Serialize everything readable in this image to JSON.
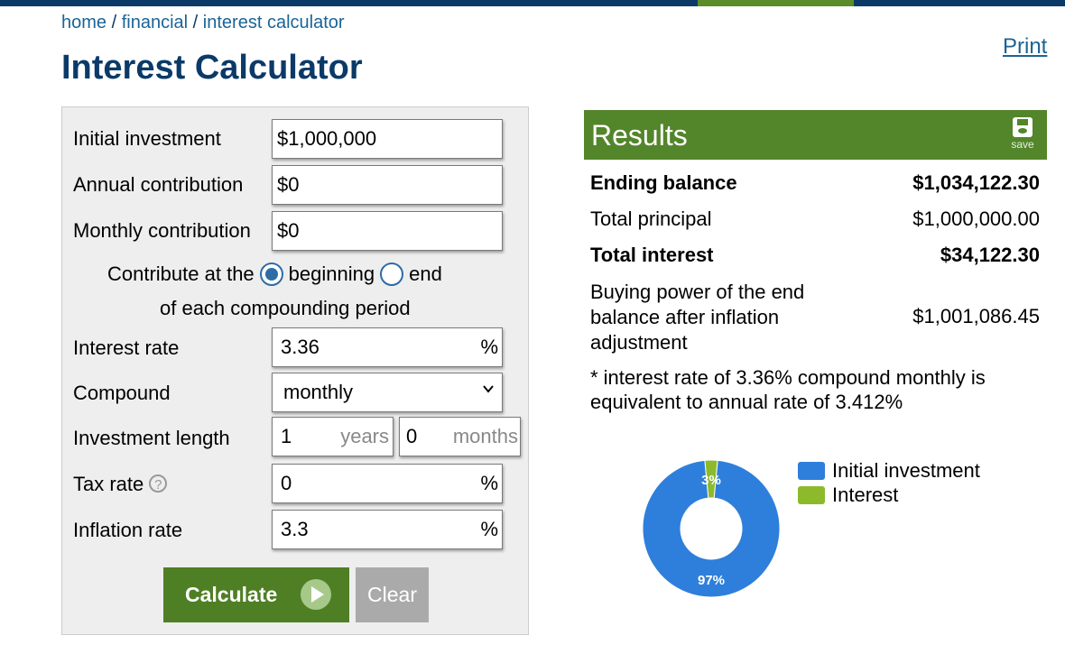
{
  "breadcrumb": {
    "home": "home",
    "sep": "/",
    "financial": "financial",
    "current": "interest calculator"
  },
  "print_label": "Print",
  "page_title": "Interest Calculator",
  "form": {
    "initial_investment": {
      "label": "Initial investment",
      "value": "$1,000,000"
    },
    "annual_contribution": {
      "label": "Annual contribution",
      "value": "$0"
    },
    "monthly_contribution": {
      "label": "Monthly contribution",
      "value": "$0"
    },
    "contribute_at": {
      "prefix": "Contribute at the",
      "option_beginning": "beginning",
      "option_end": "end",
      "selected": "beginning",
      "suffix": "of each compounding period"
    },
    "interest_rate": {
      "label": "Interest rate",
      "value": "3.36",
      "unit": "%"
    },
    "compound": {
      "label": "Compound",
      "value": "monthly"
    },
    "investment_length": {
      "label": "Investment length",
      "years_value": "1",
      "years_unit": "years",
      "months_value": "0",
      "months_unit": "months"
    },
    "tax_rate": {
      "label": "Tax rate",
      "value": "0",
      "unit": "%",
      "help": "?"
    },
    "inflation_rate": {
      "label": "Inflation rate",
      "value": "3.3",
      "unit": "%"
    },
    "calculate_label": "Calculate",
    "clear_label": "Clear"
  },
  "results": {
    "title": "Results",
    "save_label": "save",
    "ending_balance": {
      "label": "Ending balance",
      "value": "$1,034,122.30"
    },
    "total_principal": {
      "label": "Total principal",
      "value": "$1,000,000.00"
    },
    "total_interest": {
      "label": "Total interest",
      "value": "$34,122.30"
    },
    "buying_power": {
      "label": "Buying power of the end balance after inflation adjustment",
      "value": "$1,001,086.45"
    },
    "note": "* interest rate of 3.36% compound monthly is equivalent to annual rate of 3.412%"
  },
  "chart_data": {
    "type": "pie",
    "categories": [
      "Initial investment",
      "Interest"
    ],
    "values": [
      97,
      3
    ],
    "labels": [
      "97%",
      "3%"
    ],
    "colors": [
      "#2e7fdb",
      "#8dba2b"
    ],
    "legend": "right"
  }
}
